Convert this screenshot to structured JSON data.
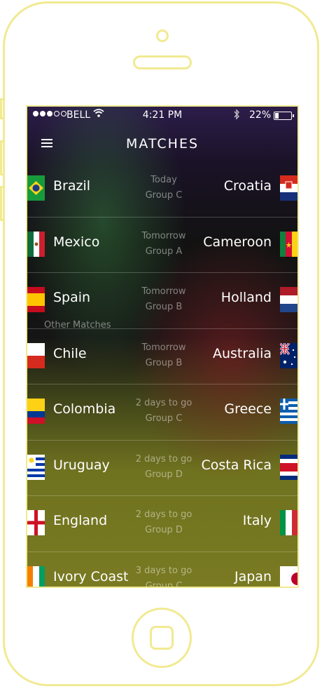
{
  "status_bar": {
    "carrier": "BELL",
    "time": "4:21 PM",
    "battery": "22%"
  },
  "header": {
    "title": "MATCHES",
    "menu_icon": "hamburger-icon"
  },
  "overlay_label": "Other Matches",
  "matches": [
    {
      "home": "Brazil",
      "home_flag": "flag-brazil",
      "away": "Croatia",
      "away_flag": "flag-croatia",
      "when": "Today",
      "group": "Group C"
    },
    {
      "home": "Mexico",
      "home_flag": "flag-mexico",
      "away": "Cameroon",
      "away_flag": "flag-cameroon",
      "when": "Tomorrow",
      "group": "Group A"
    },
    {
      "home": "Spain",
      "home_flag": "flag-spain",
      "away": "Holland",
      "away_flag": "flag-netherlands",
      "when": "Tomorrow",
      "group": "Group B"
    },
    {
      "home": "Chile",
      "home_flag": "flag-chile",
      "away": "Australia",
      "away_flag": "flag-australia",
      "when": "Tomorrow",
      "group": "Group B"
    },
    {
      "home": "Colombia",
      "home_flag": "flag-colombia",
      "away": "Greece",
      "away_flag": "flag-greece",
      "when": "2 days to go",
      "group": "Group C"
    },
    {
      "home": "Uruguay",
      "home_flag": "flag-uruguay",
      "away": "Costa Rica",
      "away_flag": "flag-costa-rica",
      "when": "2 days to go",
      "group": "Group D"
    },
    {
      "home": "England",
      "home_flag": "flag-england",
      "away": "Italy",
      "away_flag": "flag-italy",
      "when": "2 days to go",
      "group": "Group D"
    },
    {
      "home": "Ivory Coast",
      "home_flag": "flag-ivory-coast",
      "away": "Japan",
      "away_flag": "flag-japan",
      "when": "3 days to go",
      "group": "Group C"
    }
  ],
  "colors": {
    "frame": "#f1ea92",
    "accent_text": "#ffffff",
    "muted_text": "rgba(255,255,255,0.45)"
  }
}
